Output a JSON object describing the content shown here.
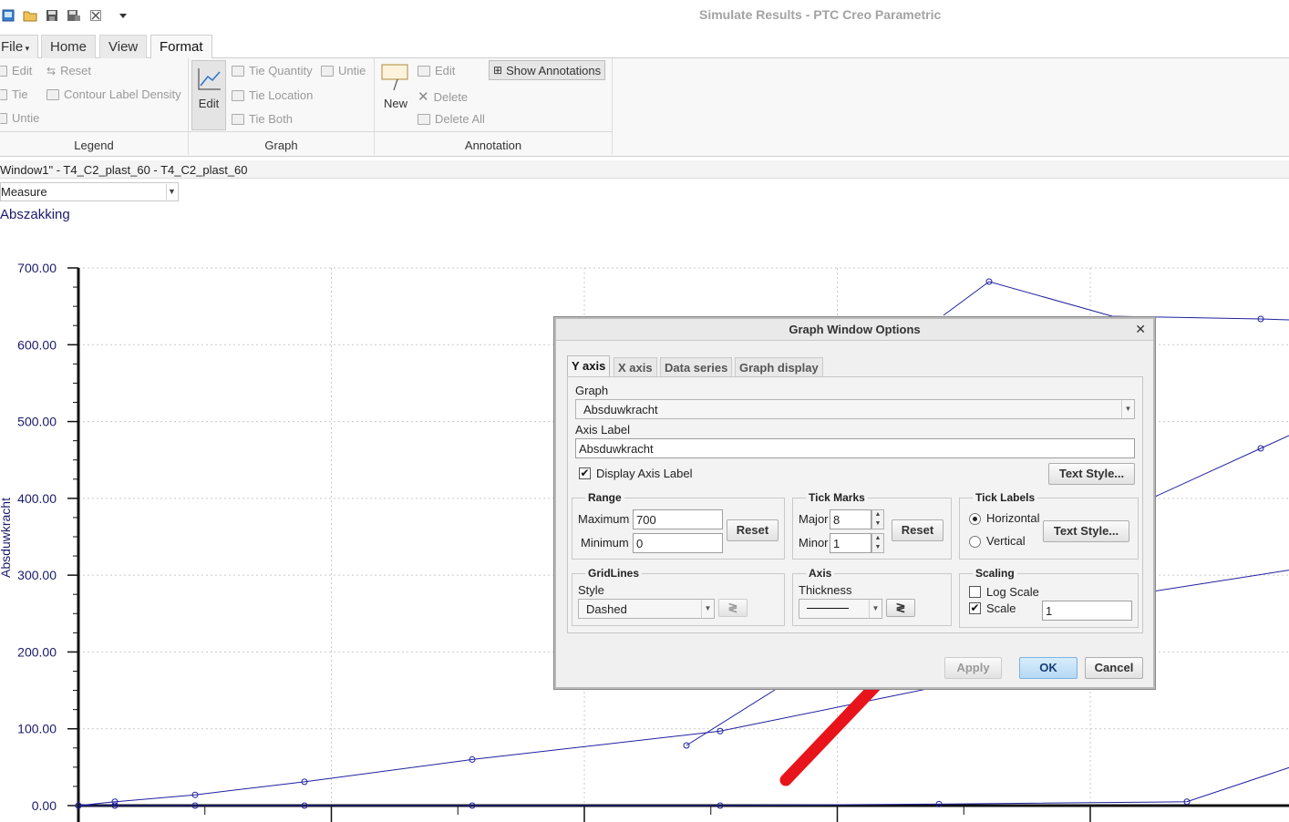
{
  "app": {
    "title": "Simulate Results - PTC Creo Parametric"
  },
  "quick_access": [
    "new-icon",
    "open-icon",
    "save-icon",
    "save-as-icon",
    "close-icon",
    "customize-dropdown-icon"
  ],
  "tabs": [
    {
      "label": "File",
      "id": "file",
      "active": false
    },
    {
      "label": "Home",
      "id": "home",
      "active": false
    },
    {
      "label": "View",
      "id": "view",
      "active": false
    },
    {
      "label": "Format",
      "id": "format",
      "active": true
    }
  ],
  "ribbon": {
    "legend": {
      "group": "Legend",
      "edit": "Edit",
      "reset": "Reset",
      "tie": "Tie",
      "untie": "Untie",
      "contour_density": "Contour Label Density"
    },
    "graph": {
      "group": "Graph",
      "edit": "Edit",
      "tie_quantity": "Tie Quantity",
      "untie": "Untie",
      "tie_location": "Tie Location",
      "tie_both": "Tie Both"
    },
    "annotation": {
      "group": "Annotation",
      "new": "New",
      "edit": "Edit",
      "delete": "Delete",
      "delete_all": "Delete All",
      "show_annotations": "Show Annotations"
    }
  },
  "window_bar": {
    "title": "Window1\" - T4_C2_plast_60 - T4_C2_plast_60"
  },
  "measure": {
    "value": "Measure"
  },
  "plot_title": "Abszakking",
  "chart_data": {
    "type": "line",
    "ylabel": "Absduwkracht",
    "ylim": [
      0,
      700
    ],
    "y_ticks": [
      "700.00",
      "600.00",
      "500.00",
      "400.00",
      "300.00",
      "200.00",
      "100.00",
      "0.00"
    ],
    "grid": "dashed",
    "series": [
      {
        "x": [
          0,
          0.5,
          1.6,
          3.1,
          5.4,
          8.8,
          11.8,
          12.8,
          17.5
        ],
        "y": [
          0,
          5,
          14,
          31,
          60,
          97,
          155,
          250,
          320
        ]
      },
      {
        "x": [
          0,
          0.5,
          1.6,
          3.1,
          5.4,
          8.8,
          11.8,
          15.2,
          17.5
        ],
        "y": [
          0,
          0,
          0,
          0,
          0,
          0,
          2,
          5,
          78
        ]
      }
    ]
  },
  "dialog": {
    "title": "Graph Window Options",
    "tabs": [
      {
        "label": "Y axis",
        "active": true
      },
      {
        "label": "X axis",
        "active": false
      },
      {
        "label": "Data series",
        "active": false
      },
      {
        "label": "Graph display",
        "active": false
      }
    ],
    "graph_label": "Graph",
    "graph_value": "Absduwkracht",
    "axis_label_label": "Axis Label",
    "axis_label_value": "Absduwkracht",
    "display_axis_label": "Display Axis Label",
    "display_axis_label_checked": true,
    "text_style": "Text Style...",
    "range": {
      "legend": "Range",
      "max_label": "Maximum",
      "max_value": "700",
      "min_label": "Minimum",
      "min_value": "0",
      "reset": "Reset"
    },
    "tick_marks": {
      "legend": "Tick Marks",
      "major_label": "Major",
      "major_value": "8",
      "minor_label": "Minor",
      "minor_value": "1",
      "reset": "Reset"
    },
    "tick_labels": {
      "legend": "Tick Labels",
      "horizontal": "Horizontal",
      "vertical": "Vertical",
      "selected": "Horizontal",
      "text_style": "Text Style..."
    },
    "gridlines": {
      "legend": "GridLines",
      "style_label": "Style",
      "style_value": "Dashed"
    },
    "axis": {
      "legend": "Axis",
      "thickness_label": "Thickness"
    },
    "scaling": {
      "legend": "Scaling",
      "log_scale": "Log Scale",
      "log_checked": false,
      "scale": "Scale",
      "scale_checked": true,
      "scale_value": "1"
    },
    "buttons": {
      "apply": "Apply",
      "ok": "OK",
      "cancel": "Cancel"
    }
  },
  "annotation_arrow": {
    "color": "#e8141b"
  }
}
